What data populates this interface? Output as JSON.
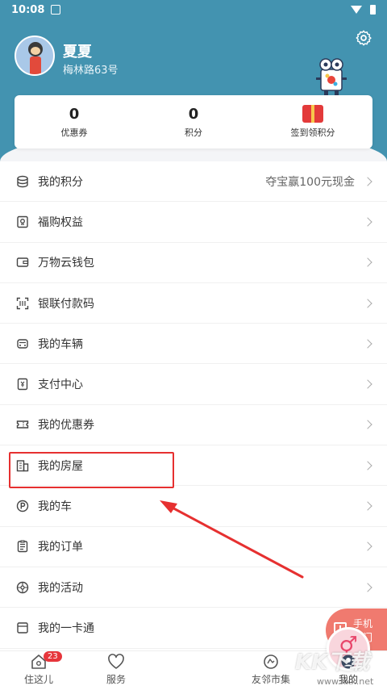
{
  "status_bar": {
    "time": "10:08"
  },
  "profile": {
    "name": "夏夏",
    "address": "梅林路63号"
  },
  "stats": [
    {
      "value": "0",
      "label": "优惠券"
    },
    {
      "value": "0",
      "label": "积分"
    },
    {
      "value": "",
      "label": "签到领积分"
    }
  ],
  "menu": [
    {
      "label": "我的积分",
      "extra": "夺宝赢100元现金",
      "icon": "coins-icon"
    },
    {
      "label": "福购权益",
      "extra": "",
      "icon": "benefit-icon"
    },
    {
      "label": "万物云钱包",
      "extra": "",
      "icon": "wallet-icon"
    },
    {
      "label": "银联付款码",
      "extra": "",
      "icon": "scan-code-icon"
    },
    {
      "label": "我的车辆",
      "extra": "",
      "icon": "car-icon"
    },
    {
      "label": "支付中心",
      "extra": "",
      "icon": "payment-icon"
    },
    {
      "label": "我的优惠券",
      "extra": "",
      "icon": "ticket-icon"
    },
    {
      "label": "我的房屋",
      "extra": "",
      "icon": "building-icon"
    },
    {
      "label": "我的车",
      "extra": "",
      "icon": "parking-icon"
    },
    {
      "label": "我的订单",
      "extra": "",
      "icon": "order-icon"
    },
    {
      "label": "我的活动",
      "extra": "",
      "icon": "activity-icon"
    },
    {
      "label": "我的一卡通",
      "extra": "",
      "icon": "card-icon"
    }
  ],
  "float_button": {
    "line1": "手机",
    "line2": "开门"
  },
  "tabs": [
    {
      "label": "住这儿",
      "badge": "23",
      "icon": "home-icon"
    },
    {
      "label": "服务",
      "badge": "",
      "icon": "heart-icon"
    },
    {
      "label": "",
      "badge": "",
      "icon": "center-logo-icon"
    },
    {
      "label": "友邻市集",
      "badge": "",
      "icon": "market-icon"
    },
    {
      "label": "我的",
      "badge": "",
      "icon": "profile-icon"
    }
  ],
  "watermark": {
    "main": "KK下载",
    "sub": "www.kkx.net"
  },
  "colors": {
    "header": "#4393b0",
    "highlight": "#e63030",
    "float": "#f07a6f"
  }
}
